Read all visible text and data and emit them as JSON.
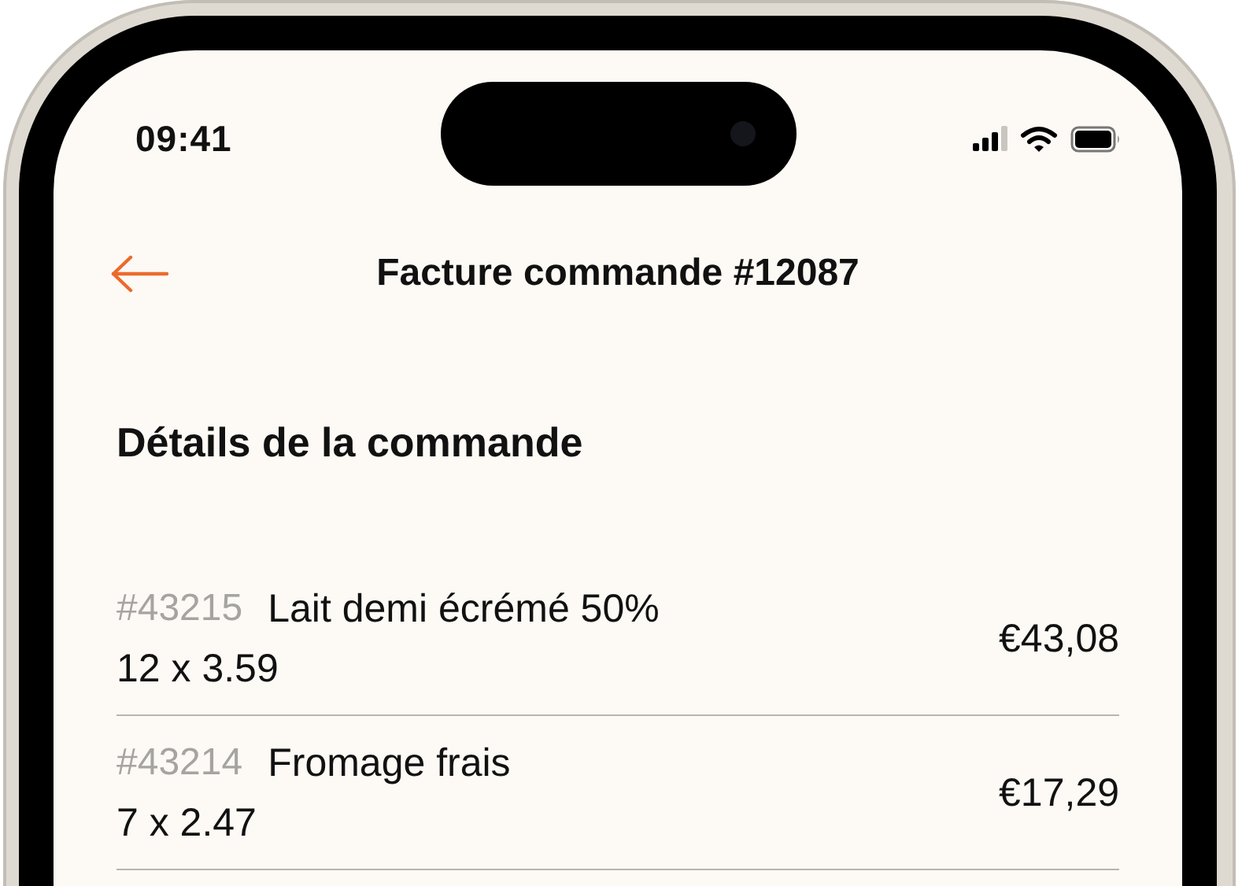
{
  "status_bar": {
    "time": "09:41"
  },
  "nav": {
    "title": "Facture commande #12087"
  },
  "section_title": "Détails de la commande",
  "items": [
    {
      "sku": "#43215",
      "name": "Lait demi écrémé 50%",
      "quantity_price": "12 x 3.59",
      "total": "€43,08"
    },
    {
      "sku": "#43214",
      "name": "Fromage frais",
      "quantity_price": "7 x 2.47",
      "total": "€17,29"
    }
  ]
}
